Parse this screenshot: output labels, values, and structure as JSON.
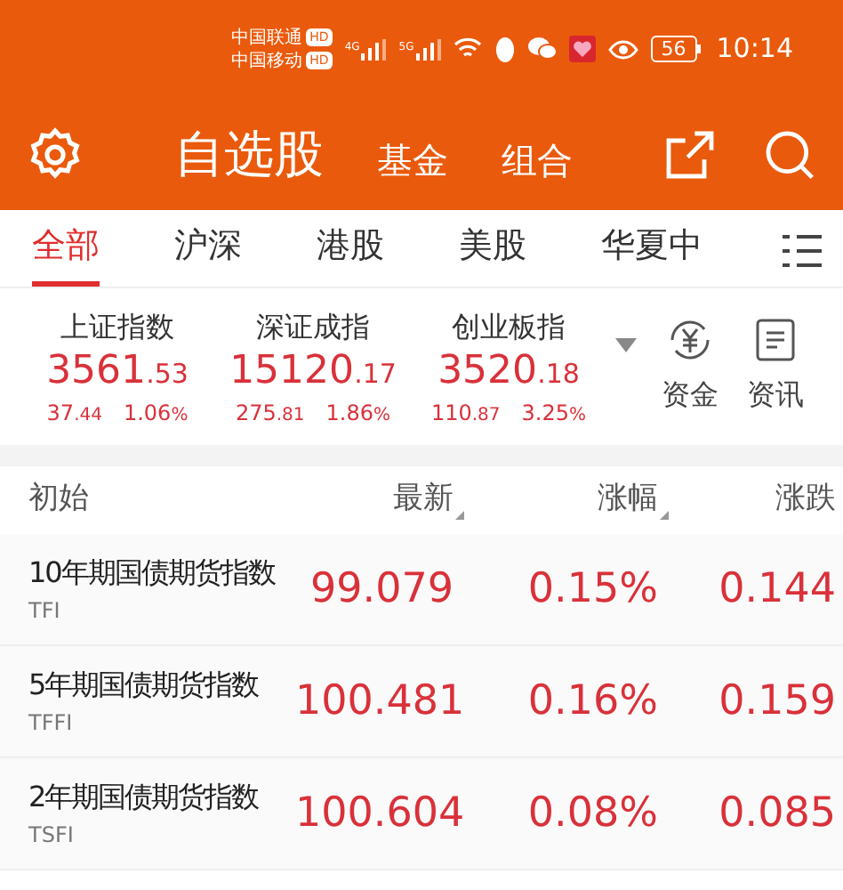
{
  "status_bar": {
    "carriers": [
      {
        "name": "中国联通",
        "badge": "HD",
        "network": "4G"
      },
      {
        "name": "中国移动",
        "badge": "HD",
        "network": "5G"
      }
    ],
    "battery": "56",
    "time": "10:14"
  },
  "header": {
    "title": "自选股",
    "links": [
      {
        "label": "基金"
      },
      {
        "label": "组合"
      }
    ]
  },
  "tabs": [
    {
      "label": "全部",
      "selected": true
    },
    {
      "label": "沪深",
      "selected": false
    },
    {
      "label": "港股",
      "selected": false
    },
    {
      "label": "美股",
      "selected": false
    },
    {
      "label": "华夏中",
      "selected": false
    }
  ],
  "indices": [
    {
      "name": "上证指数",
      "int": "3561",
      "dec": ".53",
      "change_int": "37",
      "change_dec": ".44",
      "pct": "1.06",
      "pct_sign": "%"
    },
    {
      "name": "深证成指",
      "int": "15120",
      "dec": ".17",
      "change_int": "275",
      "change_dec": ".81",
      "pct": "1.86",
      "pct_sign": "%"
    },
    {
      "name": "创业板指",
      "int": "3520",
      "dec": ".18",
      "change_int": "110",
      "change_dec": ".87",
      "pct": "3.25",
      "pct_sign": "%"
    }
  ],
  "shortcuts": [
    {
      "label": "资金",
      "kind": "yuan"
    },
    {
      "label": "资讯",
      "kind": "doc"
    }
  ],
  "table": {
    "columns": [
      {
        "label": "初始",
        "sortable": false
      },
      {
        "label": "最新",
        "sortable": true
      },
      {
        "label": "涨幅",
        "sortable": true
      },
      {
        "label": "涨跌",
        "sortable": false
      }
    ],
    "rows": [
      {
        "name": "10年期国债期货指数",
        "code": "TFI",
        "last": "99.079",
        "pct": "0.15%",
        "change": "0.144"
      },
      {
        "name": "5年期国债期货指数",
        "code": "TFFI",
        "last": "100.481",
        "pct": "0.16%",
        "change": "0.159"
      },
      {
        "name": "2年期国债期货指数",
        "code": "TSFI",
        "last": "100.604",
        "pct": "0.08%",
        "change": "0.085"
      }
    ]
  }
}
